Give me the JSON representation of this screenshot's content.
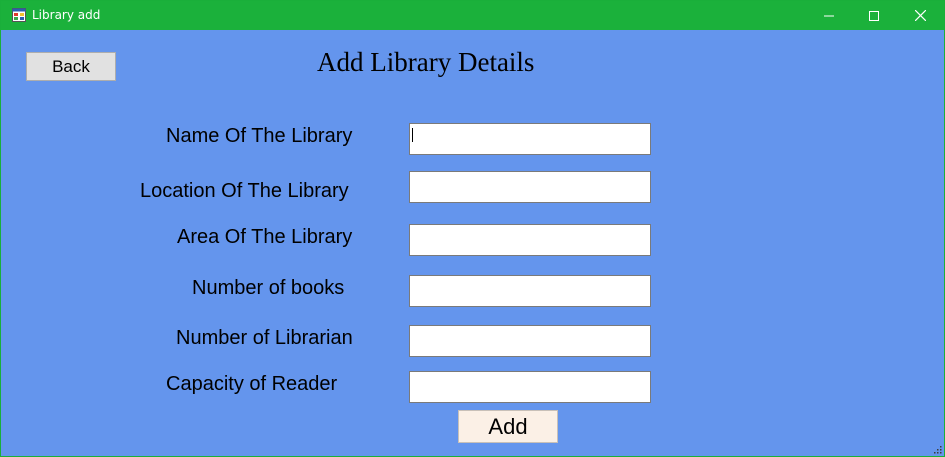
{
  "window": {
    "title": "Library add"
  },
  "header": {
    "back_label": "Back",
    "heading": "Add Library Details"
  },
  "form": {
    "fields": [
      {
        "label": "Name Of The Library",
        "value": "",
        "placeholder": ""
      },
      {
        "label": "Location Of The Library",
        "value": "",
        "placeholder": ""
      },
      {
        "label": "Area Of The Library",
        "value": "",
        "placeholder": ""
      },
      {
        "label": "Number of books",
        "value": "",
        "placeholder": ""
      },
      {
        "label": "Number of Librarian",
        "value": "",
        "placeholder": ""
      },
      {
        "label": "Capacity of Reader",
        "value": "",
        "placeholder": ""
      }
    ],
    "submit_label": "Add"
  },
  "colors": {
    "titlebar": "#1bb13b",
    "background": "#6495ed"
  },
  "icons": {
    "app": "app-form-icon",
    "minimize": "minimize-icon",
    "maximize": "maximize-icon",
    "close": "close-icon"
  }
}
